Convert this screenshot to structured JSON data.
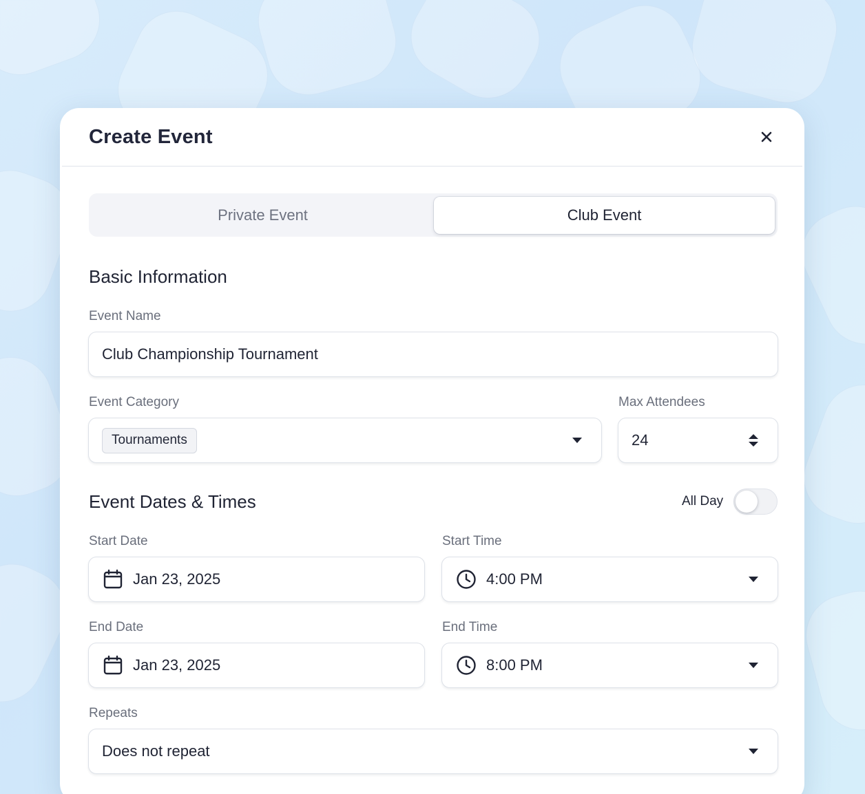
{
  "modal": {
    "title": "Create Event"
  },
  "tabs": [
    {
      "label": "Private Event",
      "active": false
    },
    {
      "label": "Club Event",
      "active": true
    }
  ],
  "basic_info": {
    "section_title": "Basic Information",
    "event_name_label": "Event Name",
    "event_name_value": "Club Championship Tournament",
    "event_category_label": "Event Category",
    "event_category_value": "Tournaments",
    "max_attendees_label": "Max Attendees",
    "max_attendees_value": "24"
  },
  "dates": {
    "section_title": "Event Dates & Times",
    "all_day_label": "All Day",
    "all_day_on": false,
    "start_date_label": "Start Date",
    "start_date_value": "Jan 23, 2025",
    "start_time_label": "Start Time",
    "start_time_value": "4:00 PM",
    "end_date_label": "End Date",
    "end_date_value": "Jan 23, 2025",
    "end_time_label": "End Time",
    "end_time_value": "8:00 PM",
    "repeats_label": "Repeats",
    "repeats_value": "Does not repeat"
  },
  "icons": {
    "close": "close-icon",
    "calendar": "calendar-icon",
    "clock": "clock-icon",
    "dropdown": "chevron-down-icon",
    "stepper": "stepper-icon"
  },
  "colors": {
    "background": "#d8ecfb",
    "card": "#ffffff",
    "text": "#1f2333",
    "muted": "#6a6f7c"
  }
}
